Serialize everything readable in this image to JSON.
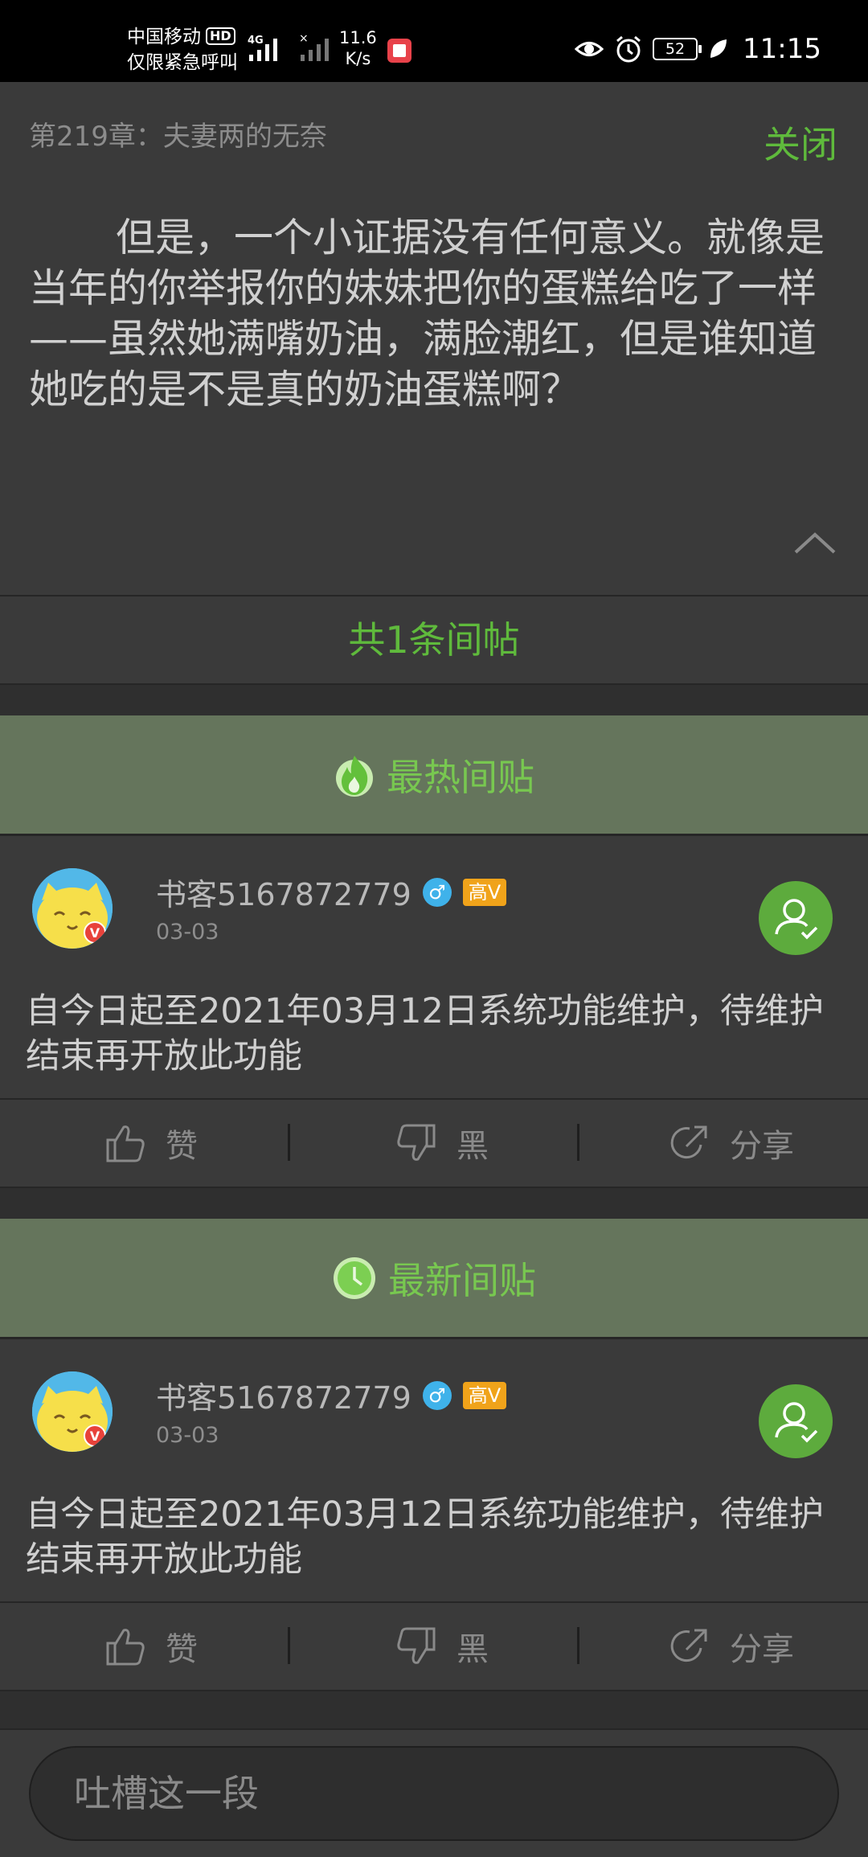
{
  "status_bar": {
    "carrier": "中国移动",
    "hd": "HD",
    "emergency": "仅限紧急呼叫",
    "net_type": "4G",
    "speed_value": "11.6",
    "speed_unit": "K/s",
    "battery": "52",
    "time": "11:15"
  },
  "chapter": {
    "title": "第219章：夫妻两的无奈",
    "close_label": "关闭",
    "text": "但是，一个小证据没有任何意义。就像是当年的你举报你的妹妹把你的蛋糕给吃了一样——虽然她满嘴奶油，满脸潮红，但是谁知道她吃的是不是真的奶油蛋糕啊？"
  },
  "count_label": "共1条间帖",
  "hot": {
    "label": "最热间贴",
    "post": {
      "username": "书客5167872779",
      "gender": "♂",
      "vip": "高V",
      "date": "03-03",
      "body": "自今日起至2021年03月12日系统功能维护，待维护结束再开放此功能",
      "like": "赞",
      "dislike": "黑",
      "share": "分享"
    }
  },
  "latest": {
    "label": "最新间贴",
    "post": {
      "username": "书客5167872779",
      "gender": "♂",
      "vip": "高V",
      "date": "03-03",
      "body": "自今日起至2021年03月12日系统功能维护，待维护结束再开放此功能",
      "like": "赞",
      "dislike": "黑",
      "share": "分享"
    }
  },
  "comment_input": {
    "placeholder": "吐槽这一段"
  },
  "colors": {
    "accent": "#5fba3c",
    "section_bg": "#65755c",
    "page_bg": "#3a3a3a"
  }
}
